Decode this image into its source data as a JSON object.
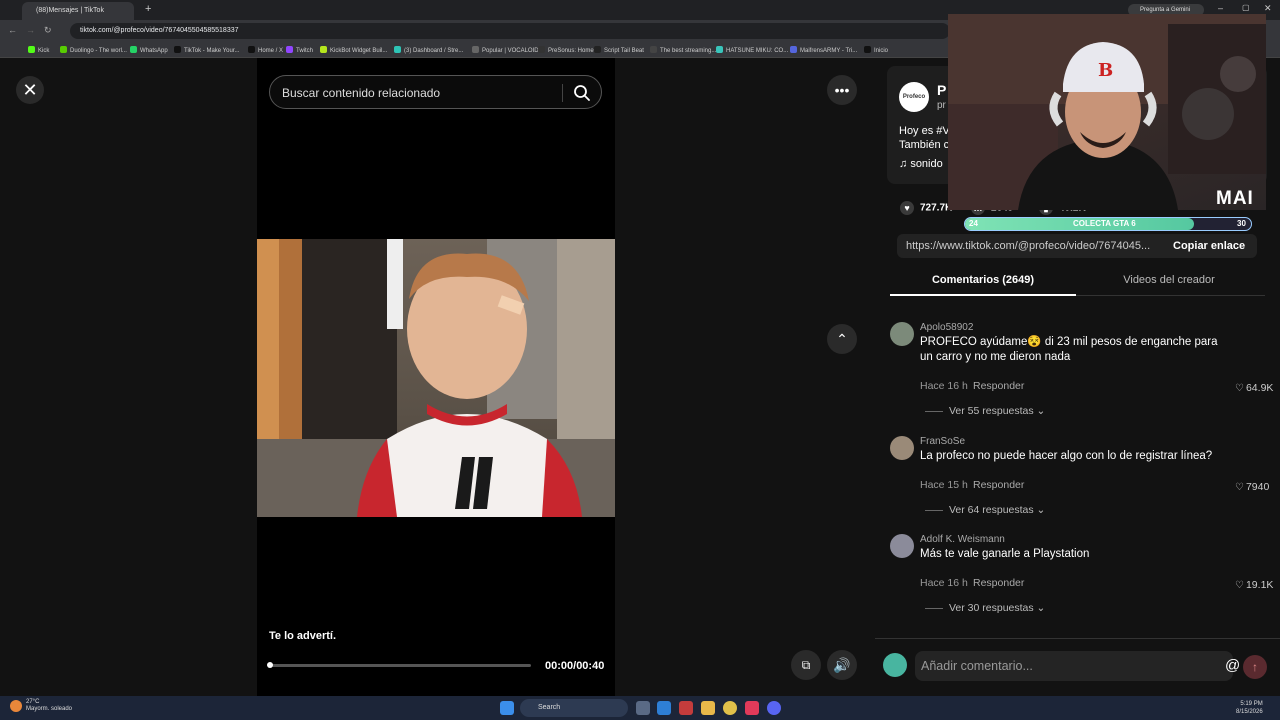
{
  "browser": {
    "tab_title": "(88)Mensajes | TikTok",
    "url": "tiktok.com/@profeco/video/7674045504585518337",
    "gemini_label": "Pregunta a Gemini",
    "bookmarks": [
      "Kick",
      "Duolingo - The worl...",
      "WhatsApp",
      "TikTok - Make Your...",
      "Home / X",
      "Twitch",
      "KickBot Widget Buil...",
      "(3) Dashboard / Stre...",
      "Popular | VOCALOID...",
      "PreSonus: Home",
      "Script Tail Beat",
      "The best streaming...",
      "HATSUNE MIKU: CO...",
      "MaifrensARMY - Tri...",
      "Inicio"
    ]
  },
  "video": {
    "search_placeholder": "Buscar contenido relacionado",
    "caption": "Te lo advertí.",
    "time": "00:00/00:40",
    "progress": 0.0
  },
  "post": {
    "author_initial": "P",
    "author_sub": "pr",
    "avatar_text": "Profeco",
    "desc_line1": "Hoy es #V",
    "desc_line2": "También c",
    "sound": "sonido",
    "likes": "727.7K",
    "comments": "2649",
    "saves": "40.2K",
    "link": "https://www.tiktok.com/@profeco/video/7674045...",
    "copy_label": "Copiar enlace"
  },
  "tabs": {
    "comments": "Comentarios (2649)",
    "creator": "Videos del creador"
  },
  "comments": [
    {
      "user": "Apolo58902",
      "text": "PROFECO ayúdame😵 di 23 mil pesos de enganche para un carro y no me dieron nada",
      "time": "Hace 16 h",
      "reply": "Responder",
      "likes": "64.9K",
      "more": "Ver 55 respuestas"
    },
    {
      "user": "FranSoSe",
      "text": "La profeco no puede hacer algo con lo de registrar línea?",
      "time": "Hace 15 h",
      "reply": "Responder",
      "likes": "7940",
      "more": "Ver 64 respuestas"
    },
    {
      "user": "Adolf K. Weismann",
      "text": "Más te vale ganarle a Playstation",
      "time": "Hace 16 h",
      "reply": "Responder",
      "likes": "19.1K",
      "more": "Ver 30 respuestas"
    }
  ],
  "comment_bar": {
    "placeholder": "Añadir comentario..."
  },
  "overlay": {
    "gta_left": "24",
    "gta_label": "COLECTA GTA 6",
    "gta_right": "30",
    "gta_progress": 0.8,
    "brand": "MAI"
  },
  "taskbar": {
    "temp": "27°C",
    "weather": "Mayorm. soleado",
    "search": "Search",
    "time": "5:19 PM",
    "date": "8/15/2026"
  },
  "colors": {
    "background": "#121212",
    "like_heart": "#ffffff",
    "send_button": "#5a2a2f",
    "taskbar": "#1c2538"
  }
}
